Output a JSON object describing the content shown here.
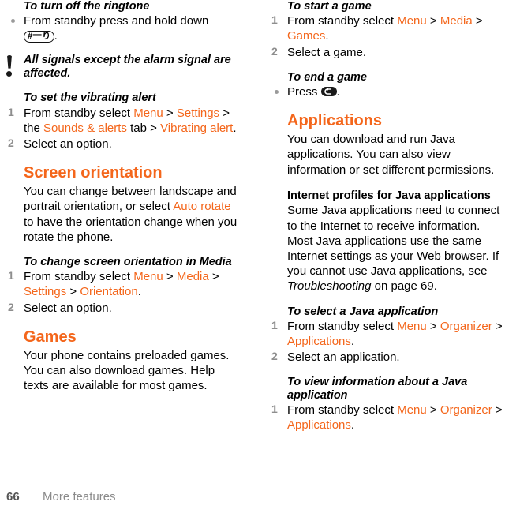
{
  "document": {
    "footer": {
      "page_number": "66",
      "title": "More features"
    },
    "accent_color": "#F4661B",
    "step_number_color": "#8e8e8e"
  },
  "left_column": {
    "ringtone_proc": {
      "title": "To turn off the ringtone",
      "bullet_text_before": "From standby press and hold down ",
      "key_icon": "hash-key-icon",
      "key_label_hash": "#",
      "key_label_suffix": "り",
      "bullet_text_after": "."
    },
    "note": {
      "text": "All signals except the alarm signal are affected.",
      "icon": "exclamation-note-icon"
    },
    "vibrating_proc": {
      "title": "To set the vibrating alert",
      "steps": [
        {
          "num": "1",
          "segments": [
            {
              "text": "From standby select ",
              "style": "plain"
            },
            {
              "text": "Menu",
              "style": "menu"
            },
            {
              "text": " > ",
              "style": "plain"
            },
            {
              "text": "Settings",
              "style": "menu"
            },
            {
              "text": " > the ",
              "style": "plain"
            },
            {
              "text": "Sounds & alerts",
              "style": "menu"
            },
            {
              "text": " tab > ",
              "style": "plain"
            },
            {
              "text": "Vibrating alert",
              "style": "menu"
            },
            {
              "text": ".",
              "style": "plain"
            }
          ]
        },
        {
          "num": "2",
          "segments": [
            {
              "text": "Select an option.",
              "style": "plain"
            }
          ]
        }
      ]
    },
    "screen_orientation": {
      "heading": "Screen orientation",
      "paragraph_segments": [
        {
          "text": "You can change between landscape and portrait orientation, or select ",
          "style": "plain"
        },
        {
          "text": "Auto rotate",
          "style": "menu"
        },
        {
          "text": " to have the orientation change when you rotate the phone.",
          "style": "plain"
        }
      ],
      "proc": {
        "title": "To change screen orientation in Media",
        "steps": [
          {
            "num": "1",
            "segments": [
              {
                "text": "From standby select ",
                "style": "plain"
              },
              {
                "text": "Menu",
                "style": "menu"
              },
              {
                "text": " > ",
                "style": "plain"
              },
              {
                "text": "Media",
                "style": "menu"
              },
              {
                "text": " > ",
                "style": "plain"
              },
              {
                "text": "Settings",
                "style": "menu"
              },
              {
                "text": " > ",
                "style": "plain"
              },
              {
                "text": "Orientation",
                "style": "menu"
              },
              {
                "text": ".",
                "style": "plain"
              }
            ]
          },
          {
            "num": "2",
            "segments": [
              {
                "text": "Select an option.",
                "style": "plain"
              }
            ]
          }
        ]
      }
    },
    "games": {
      "heading": "Games",
      "paragraph": "Your phone contains preloaded games. You can also download games. Help texts are available for most games."
    }
  },
  "right_column": {
    "start_game_proc": {
      "title": "To start a game",
      "steps": [
        {
          "num": "1",
          "segments": [
            {
              "text": "From standby select ",
              "style": "plain"
            },
            {
              "text": "Menu",
              "style": "menu"
            },
            {
              "text": " > ",
              "style": "plain"
            },
            {
              "text": "Media",
              "style": "menu"
            },
            {
              "text": " > ",
              "style": "plain"
            },
            {
              "text": "Games",
              "style": "menu"
            },
            {
              "text": ".",
              "style": "plain"
            }
          ]
        },
        {
          "num": "2",
          "segments": [
            {
              "text": "Select a game.",
              "style": "plain"
            }
          ]
        }
      ]
    },
    "end_game_proc": {
      "title": "To end a game",
      "bullet_text_before": "Press ",
      "key_icon": "back-key-icon",
      "bullet_text_after": "."
    },
    "applications": {
      "heading": "Applications",
      "paragraph": "You can download and run Java applications. You can also view information or set different permissions.",
      "internet_profiles": {
        "sub_heading": "Internet profiles for Java applications",
        "paragraph_segments": [
          {
            "text": "Some Java applications need to connect to the Internet to receive information. Most Java applications use the same Internet settings as your Web browser. If you cannot use Java applications, see ",
            "style": "plain"
          },
          {
            "text": "Troubleshooting",
            "style": "italic"
          },
          {
            "text": " on page 69.",
            "style": "plain"
          }
        ]
      },
      "select_proc": {
        "title": "To select a Java application",
        "steps": [
          {
            "num": "1",
            "segments": [
              {
                "text": "From standby select ",
                "style": "plain"
              },
              {
                "text": "Menu",
                "style": "menu"
              },
              {
                "text": " > ",
                "style": "plain"
              },
              {
                "text": "Organizer",
                "style": "menu"
              },
              {
                "text": " > ",
                "style": "plain"
              },
              {
                "text": "Applications",
                "style": "menu"
              },
              {
                "text": ".",
                "style": "plain"
              }
            ]
          },
          {
            "num": "2",
            "segments": [
              {
                "text": "Select an application.",
                "style": "plain"
              }
            ]
          }
        ]
      },
      "view_info_proc": {
        "title": "To view information about a Java application",
        "steps": [
          {
            "num": "1",
            "segments": [
              {
                "text": "From standby select ",
                "style": "plain"
              },
              {
                "text": "Menu",
                "style": "menu"
              },
              {
                "text": " > ",
                "style": "plain"
              },
              {
                "text": "Organizer",
                "style": "menu"
              },
              {
                "text": " > ",
                "style": "plain"
              },
              {
                "text": "Applications",
                "style": "menu"
              },
              {
                "text": ".",
                "style": "plain"
              }
            ]
          }
        ]
      }
    }
  }
}
